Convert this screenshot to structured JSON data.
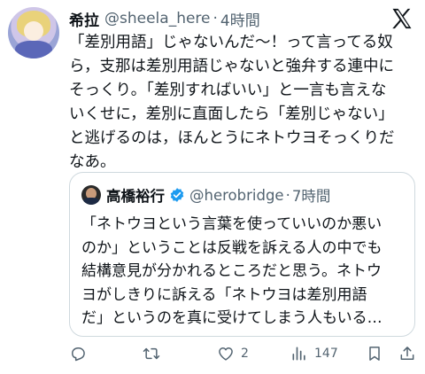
{
  "author": {
    "display_name": "希拉",
    "handle": "@sheela_here",
    "separator": "·",
    "time": "4時間"
  },
  "tweet_lines": [
    "「差別用語」じゃないんだ〜！って言ってる奴",
    "ら，支那は差別用語じゃないと強弁する連中に",
    "そっくり。「差別すればいい」と一言も言えな",
    "いくせに，差別に直面したら「差別じゃない」",
    "と逃げるのは，ほんとうにネトウヨそっくりだ",
    "なあ。"
  ],
  "quote": {
    "display_name": "高橋裕行",
    "handle": "@herobridge",
    "separator": "·",
    "time": "7時間",
    "lines": [
      "「ネトウヨという言葉を使っていいのか悪い",
      "のか」ということは反戦を訴える人の中でも",
      "結構意見が分かれるところだと思う。ネトウ",
      "ヨがしきりに訴える「ネトウヨは差別用語",
      "だ」というのを真に受けてしまう人もいる…"
    ]
  },
  "actions": {
    "reply_icon": "reply-icon",
    "retweet_icon": "retweet-icon",
    "like_icon": "like-icon",
    "like_count": "2",
    "views_icon": "views-icon",
    "views_count": "147",
    "bookmark_icon": "bookmark-icon",
    "share_icon": "share-icon"
  },
  "colors": {
    "text": "#0f1419",
    "secondary": "#536471",
    "border": "#cfd9de",
    "verified": "#1d9bf0"
  }
}
